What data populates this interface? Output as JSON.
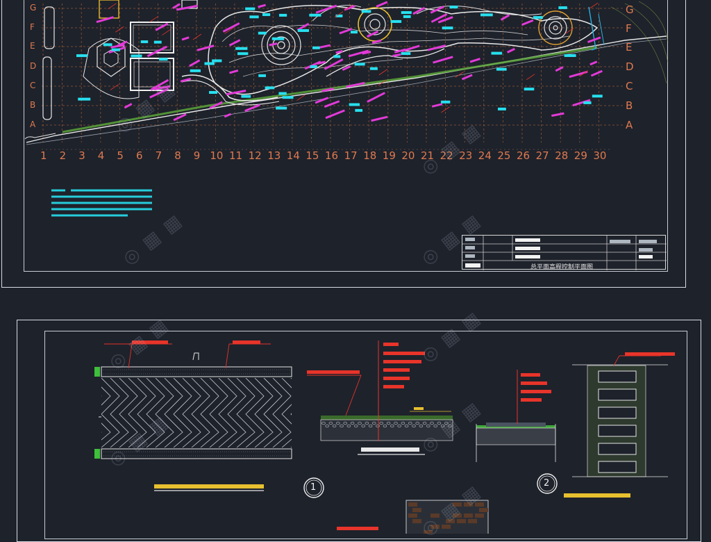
{
  "top_sheet": {
    "row_letters_left": [
      "G",
      "F",
      "E",
      "D",
      "C",
      "B",
      "A"
    ],
    "row_letters_right": [
      "G",
      "F",
      "E",
      "D",
      "C",
      "B",
      "A"
    ],
    "column_numbers": [
      "1",
      "2",
      "3",
      "4",
      "5",
      "6",
      "7",
      "8",
      "9",
      "10",
      "11",
      "12",
      "13",
      "14",
      "15",
      "16",
      "17",
      "18",
      "19",
      "20",
      "21",
      "22",
      "23",
      "24",
      "25",
      "26",
      "27",
      "28",
      "29",
      "30"
    ],
    "title_block": {
      "drawing_name": "总平面高程控制平面图"
    }
  },
  "bottom_sheet": {
    "detail_markers": [
      "1",
      "2"
    ]
  },
  "colors": {
    "background": "#1e222b",
    "grid_numbers": "#e07a4f",
    "annotation_magenta": "#e23ad8",
    "annotation_red": "#e8342a",
    "cyan_notes": "#27e0ef",
    "border": "#d8dde4",
    "green_area": "#5aa43a"
  }
}
